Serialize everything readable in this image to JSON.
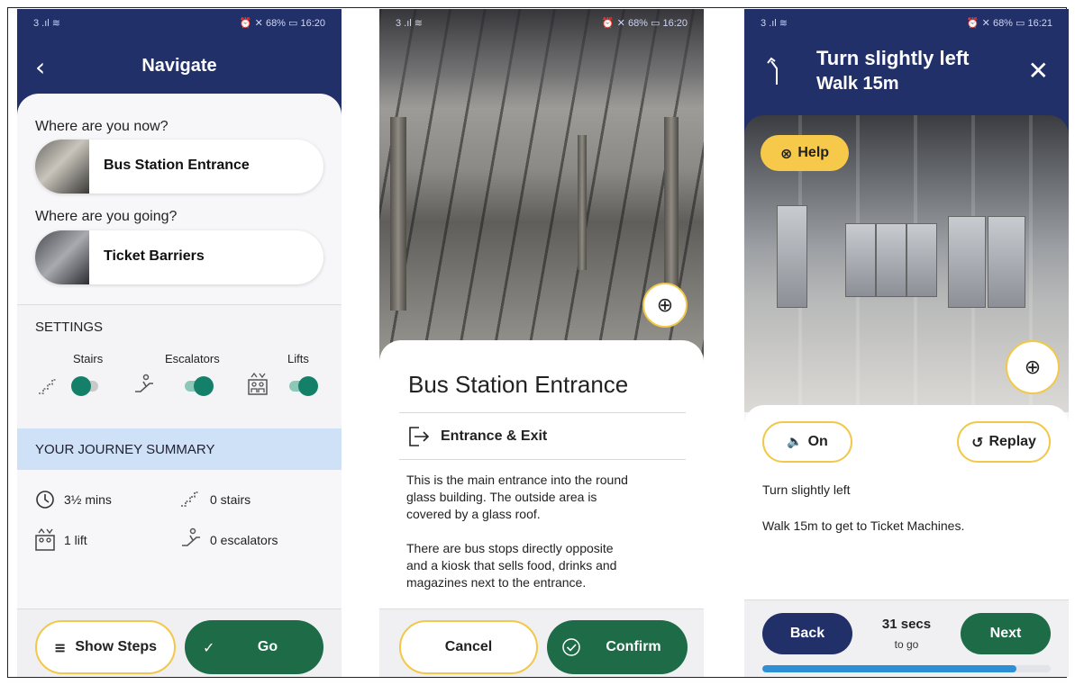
{
  "status": {
    "left": "3 .ıl ≋",
    "right_1": "⏰ ✕ 68% ▭ 16:20",
    "right_2": "⏰ ✕ 68% ▭ 16:20",
    "right_3": "⏰ ✕ 68% ▭ 16:21"
  },
  "navigate": {
    "title": "Navigate",
    "from_question": "Where are you now?",
    "from_place": "Bus Station Entrance",
    "to_question": "Where are you going?",
    "to_place": "Ticket Barriers",
    "settings_header": "SETTINGS",
    "settings": [
      {
        "label": "Stairs",
        "on": false
      },
      {
        "label": "Escalators",
        "on": true
      },
      {
        "label": "Lifts",
        "on": true
      }
    ],
    "summary_header": "YOUR JOURNEY SUMMARY",
    "summary": {
      "time": "3½ mins",
      "stairs": "0 stairs",
      "lifts": "1 lift",
      "escalators": "0 escalators"
    },
    "show_steps_label": "Show Steps",
    "go_label": "Go"
  },
  "place": {
    "title": "Bus Station Entrance",
    "subtitle": "Entrance & Exit",
    "desc_1_line_1": "This is the main entrance into the round",
    "desc_1_line_2": "glass building. The outside area is",
    "desc_1_line_3": "covered by a glass roof.",
    "desc_2_line_1": "There are bus stops directly opposite",
    "desc_2_line_2": "and a kiosk that sells food, drinks and",
    "desc_2_line_3": "magazines next to the entrance.",
    "cancel_label": "Cancel",
    "confirm_label": "Confirm"
  },
  "step": {
    "instruction": "Turn slightly left",
    "distance": "Walk 15m",
    "help_label": "Help",
    "sound_label": "On",
    "replay_label": "Replay",
    "text_1": "Turn slightly left",
    "text_2": "Walk 15m to get to Ticket Machines.",
    "back_label": "Back",
    "next_label": "Next",
    "time_remaining": "31 secs",
    "time_suffix": "to go",
    "progress": 0.88
  },
  "icons": {
    "back": "back-chevron-icon",
    "stairs": "stairs-icon",
    "escalator": "escalator-icon",
    "lift": "lift-icon",
    "clock": "clock-icon",
    "zoom": "zoom-in-icon",
    "exit": "exit-door-icon",
    "help": "lifebuoy-icon",
    "speaker": "speaker-icon",
    "replay": "replay-icon",
    "close": "close-icon",
    "turn": "turn-slight-left-icon"
  },
  "colors": {
    "navy": "#22306a",
    "green": "#1d6b47",
    "yellow": "#f1c84a",
    "summary_bg": "#cfe1f7",
    "progress": "#2d8fd6"
  }
}
